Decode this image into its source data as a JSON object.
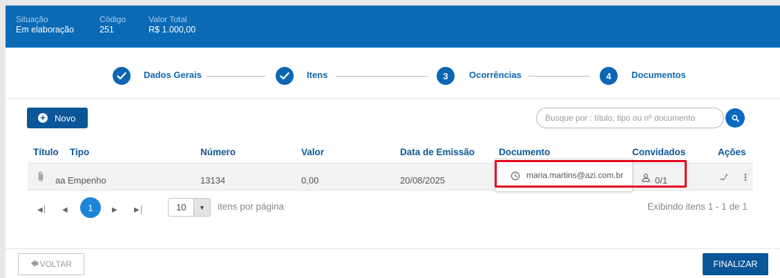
{
  "header": {
    "fields": [
      {
        "label": "Situação",
        "value": "Em elaboração"
      },
      {
        "label": "Código",
        "value": "251"
      },
      {
        "label": "Valor Total",
        "value": "R$ 1.000,00"
      }
    ]
  },
  "stepper": {
    "steps": [
      {
        "marker": "✓",
        "label": "Dados Gerais",
        "state": "done"
      },
      {
        "marker": "✓",
        "label": "Itens",
        "state": "done"
      },
      {
        "marker": "3",
        "label": "Ocorrências",
        "state": "pending"
      },
      {
        "marker": "4",
        "label": "Documentos",
        "state": "current"
      }
    ]
  },
  "toolbar": {
    "novo_label": "Novo",
    "search_placeholder": "Busque por : título, tipo ou nº documento"
  },
  "table": {
    "headers": [
      "Título",
      "Tipo",
      "Número",
      "Valor",
      "Data de Emissão",
      "Documento",
      "Convidados",
      "Ações"
    ],
    "rows": [
      {
        "titulo": "aa",
        "tipo": "Empenho",
        "numero": "13134",
        "valor": "0,00",
        "data": "20/08/2025",
        "documento": "",
        "convidados": "0/1"
      }
    ]
  },
  "tooltip": {
    "text": "maria.martins@azi.com.br"
  },
  "pagination": {
    "current_page": "1",
    "per_page": "10",
    "per_page_label": "itens por página",
    "summary": "Exibindo itens 1 - 1 de 1"
  },
  "footer": {
    "voltar_label": "VOLTAR",
    "finalizar_label": "FINALIZAR"
  },
  "colors": {
    "primary": "#0a6ab6",
    "dark_button": "#0b5599",
    "highlight": "#e8001a"
  }
}
